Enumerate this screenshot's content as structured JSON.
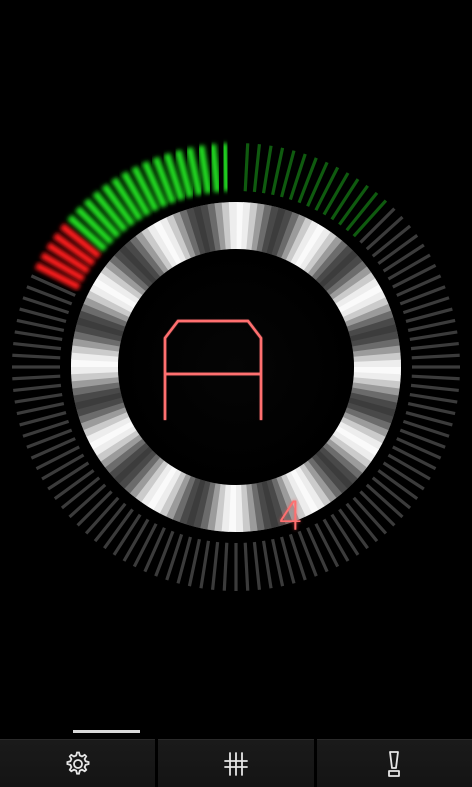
{
  "tuner": {
    "note": "A",
    "octave": "4",
    "note_color": "#ff6f6f",
    "indicator": {
      "flat_warning_color": "#ff1a1a",
      "in_tune_color": "#22e022",
      "in_range_dim_color": "#0f5a0f",
      "inactive_color": "#3b3b3b"
    }
  },
  "toolbar": {
    "buttons": [
      {
        "name": "settings",
        "icon": "gear-icon"
      },
      {
        "name": "tuning",
        "icon": "sliders-icon"
      },
      {
        "name": "alert",
        "icon": "exclamation-icon"
      }
    ]
  },
  "pager": {
    "active_page": 1
  }
}
